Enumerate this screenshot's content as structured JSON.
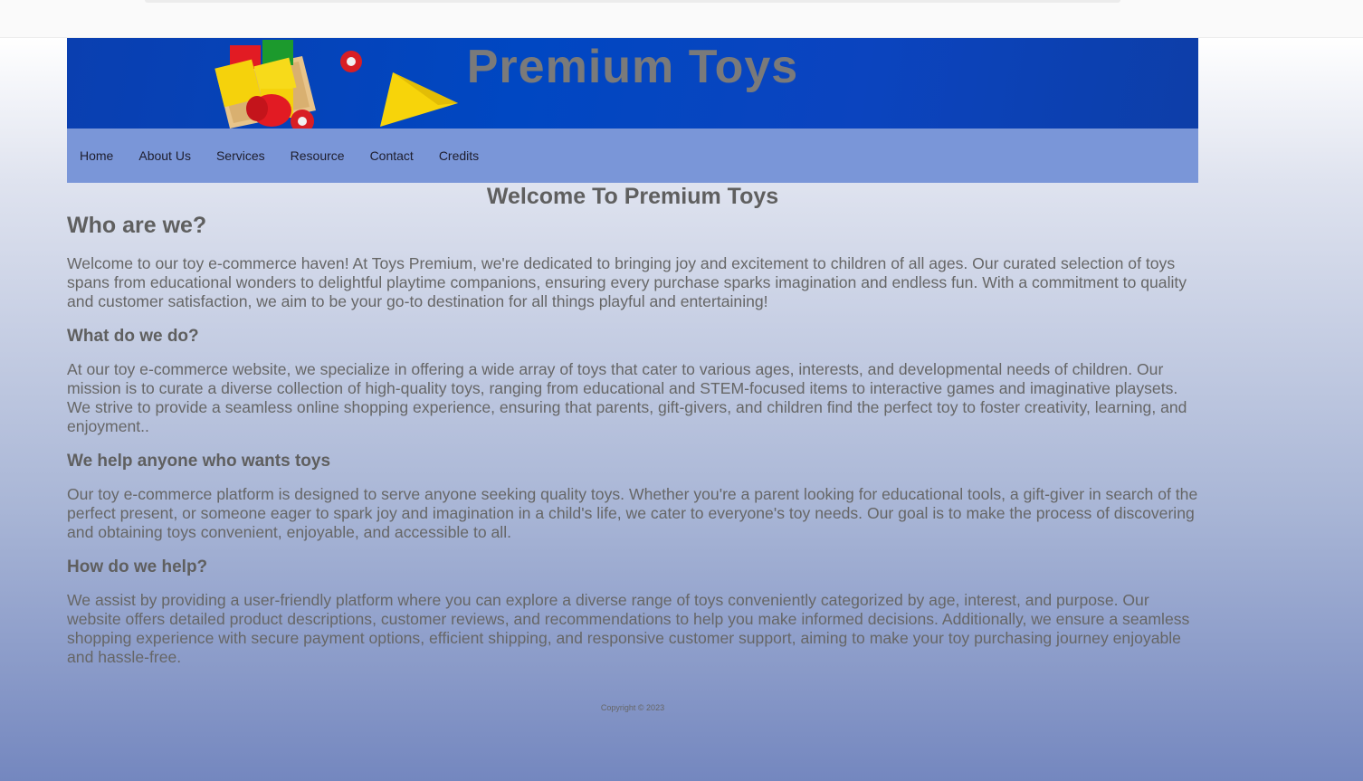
{
  "header": {
    "brand_title": "Premium Toys"
  },
  "nav": {
    "items": [
      "Home",
      "About Us",
      "Services",
      "Resource",
      "Contact",
      "Credits"
    ]
  },
  "main": {
    "page_heading": "Welcome To Premium Toys",
    "who_heading": "Who are we?",
    "who_text": "Welcome to our toy e-commerce haven! At Toys Premium, we're dedicated to bringing joy and excitement to children of all ages. Our curated selection of toys spans from educational wonders to delightful playtime companions, ensuring every purchase sparks imagination and endless fun. With a commitment to quality and customer satisfaction, we aim to be your go-to destination for all things playful and entertaining!",
    "what_heading": "What do we do?",
    "what_text": "At our toy e-commerce website, we specialize in offering a wide array of toys that cater to various ages, interests, and developmental needs of children. Our mission is to curate a diverse collection of high-quality toys, ranging from educational and STEM-focused items to interactive games and imaginative playsets. We strive to provide a seamless online shopping experience, ensuring that parents, gift-givers, and children find the perfect toy to foster creativity, learning, and enjoyment..",
    "help_anyone_heading": "We help anyone who wants toys",
    "help_anyone_text": "Our toy e-commerce platform is designed to serve anyone seeking quality toys. Whether you're a parent looking for educational tools, a gift-giver in search of the perfect present, or someone eager to spark joy and imagination in a child's life, we cater to everyone's toy needs. Our goal is to make the process of discovering and obtaining toys convenient, enjoyable, and accessible to all.",
    "how_heading": "How do we help?",
    "how_text": "We assist by providing a user-friendly platform where you can explore a diverse range of toys conveniently categorized by age, interest, and purpose. Our website offers detailed product descriptions, customer reviews, and recommendations to help you make informed decisions. Additionally, we ensure a seamless shopping experience with secure payment options, efficient shipping, and responsive customer support, aiming to make your toy purchasing journey enjoyable and hassle-free."
  },
  "footer": {
    "copyright": "Copyright © 2023"
  },
  "colors": {
    "banner_blue": "#0047c2",
    "nav_bar": "#7a96d8",
    "text_gray": "#666666"
  }
}
